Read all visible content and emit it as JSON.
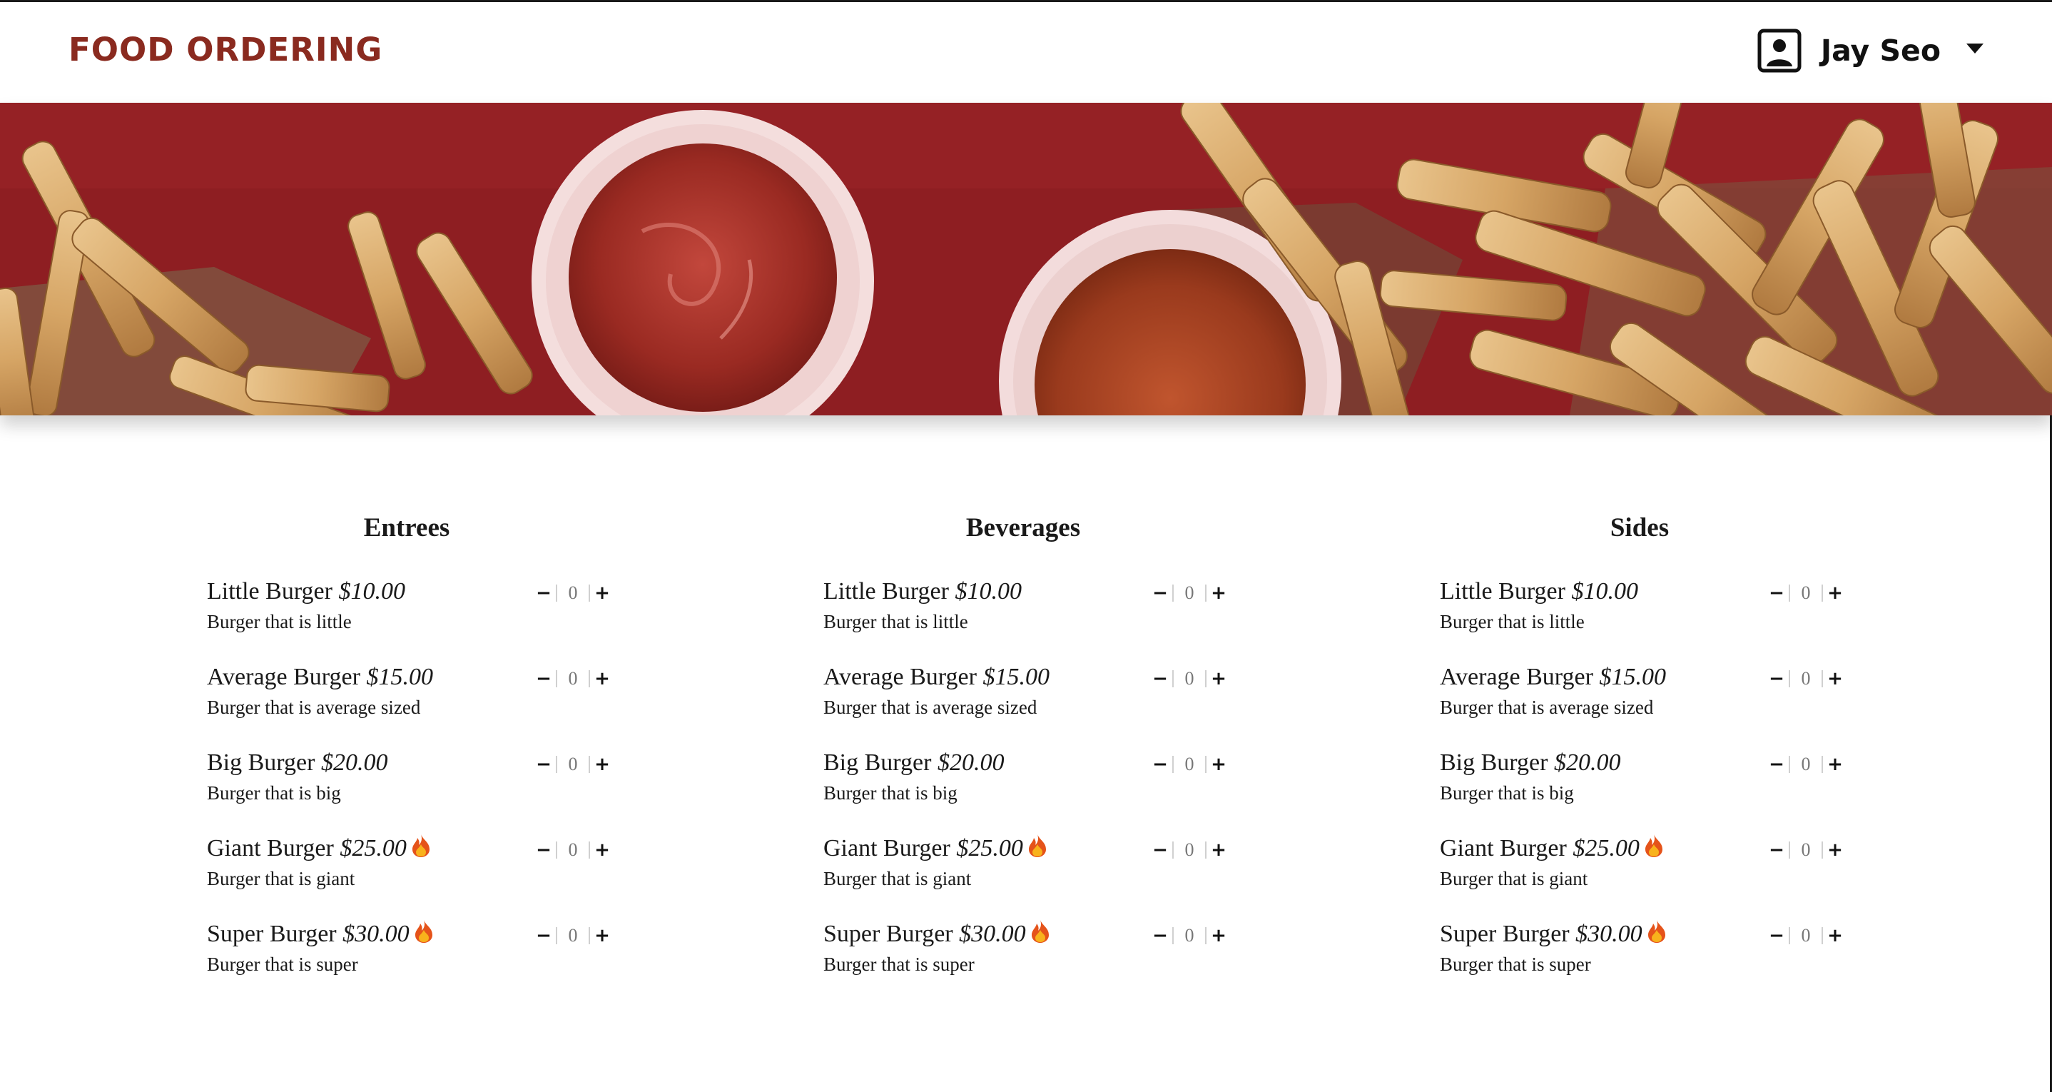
{
  "app": {
    "brand": "FOOD ORDERING",
    "user_name": "Jay Seo",
    "icons": {
      "user": "account-box-icon",
      "dropdown": "caret-down-icon",
      "spicy": "fire-icon"
    },
    "colors": {
      "brand": "#8a2a1f",
      "hero_bg": "#8e1e22"
    }
  },
  "menu": {
    "columns": [
      {
        "title": "Entrees",
        "items": [
          {
            "name": "Little Burger",
            "price": "$10.00",
            "desc": "Burger that is little",
            "qty": "0",
            "spicy": false
          },
          {
            "name": "Average Burger",
            "price": "$15.00",
            "desc": "Burger that is average sized",
            "qty": "0",
            "spicy": false
          },
          {
            "name": "Big Burger",
            "price": "$20.00",
            "desc": "Burger that is big",
            "qty": "0",
            "spicy": false
          },
          {
            "name": "Giant Burger",
            "price": "$25.00",
            "desc": "Burger that is giant",
            "qty": "0",
            "spicy": true
          },
          {
            "name": "Super Burger",
            "price": "$30.00",
            "desc": "Burger that is super",
            "qty": "0",
            "spicy": true
          }
        ]
      },
      {
        "title": "Beverages",
        "items": [
          {
            "name": "Little Burger",
            "price": "$10.00",
            "desc": "Burger that is little",
            "qty": "0",
            "spicy": false
          },
          {
            "name": "Average Burger",
            "price": "$15.00",
            "desc": "Burger that is average sized",
            "qty": "0",
            "spicy": false
          },
          {
            "name": "Big Burger",
            "price": "$20.00",
            "desc": "Burger that is big",
            "qty": "0",
            "spicy": false
          },
          {
            "name": "Giant Burger",
            "price": "$25.00",
            "desc": "Burger that is giant",
            "qty": "0",
            "spicy": true
          },
          {
            "name": "Super Burger",
            "price": "$30.00",
            "desc": "Burger that is super",
            "qty": "0",
            "spicy": true
          }
        ]
      },
      {
        "title": "Sides",
        "items": [
          {
            "name": "Little Burger",
            "price": "$10.00",
            "desc": "Burger that is little",
            "qty": "0",
            "spicy": false
          },
          {
            "name": "Average Burger",
            "price": "$15.00",
            "desc": "Burger that is average sized",
            "qty": "0",
            "spicy": false
          },
          {
            "name": "Big Burger",
            "price": "$20.00",
            "desc": "Burger that is big",
            "qty": "0",
            "spicy": false
          },
          {
            "name": "Giant Burger",
            "price": "$25.00",
            "desc": "Burger that is giant",
            "qty": "0",
            "spicy": true
          },
          {
            "name": "Super Burger",
            "price": "$30.00",
            "desc": "Burger that is super",
            "qty": "0",
            "spicy": true
          }
        ]
      }
    ]
  }
}
